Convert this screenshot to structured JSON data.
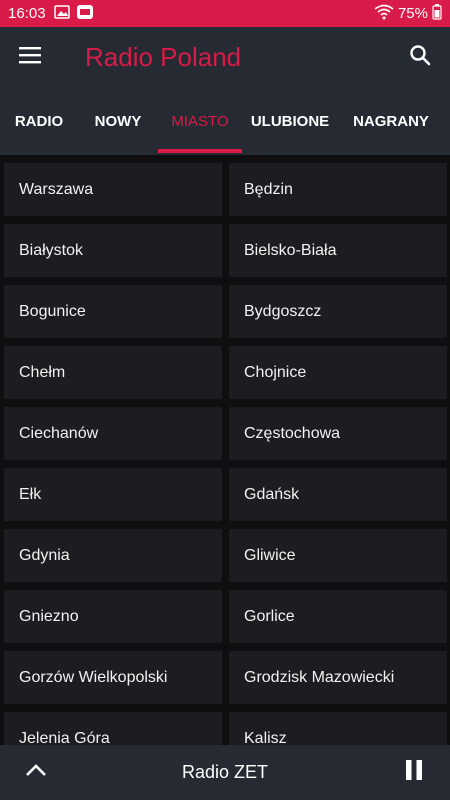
{
  "status": {
    "time": "16:03",
    "battery": "75%",
    "left_icons": [
      "image-icon",
      "app-notification-icon"
    ],
    "right_icons": [
      "wifi-icon",
      "battery-icon"
    ]
  },
  "app": {
    "title": "Radio Poland",
    "accent": "#d81b48",
    "icons": [
      "menu-icon",
      "search-icon"
    ]
  },
  "tabs": [
    {
      "label": "RADIO",
      "active": false
    },
    {
      "label": "NOWY",
      "active": false
    },
    {
      "label": "MIASTO",
      "active": true
    },
    {
      "label": "ULUBIONE",
      "active": false
    },
    {
      "label": "NAGRANY",
      "active": false
    }
  ],
  "cities": [
    "Warszawa",
    "Będzin",
    "Białystok",
    "Bielsko-Biała",
    "Bogunice",
    "Bydgoszcz",
    "Chełm",
    "Chojnice",
    "Ciechanów",
    "Częstochowa",
    "Ełk",
    "Gdańsk",
    "Gdynia",
    "Gliwice",
    "Gniezno",
    "Gorlice",
    "Gorzów Wielkopolski",
    "Grodzisk Mazowiecki",
    "Jelenia Góra",
    "Kalisz"
  ],
  "player": {
    "now_playing": "Radio ZET",
    "icons": [
      "chevron-up-icon",
      "pause-icon"
    ]
  }
}
